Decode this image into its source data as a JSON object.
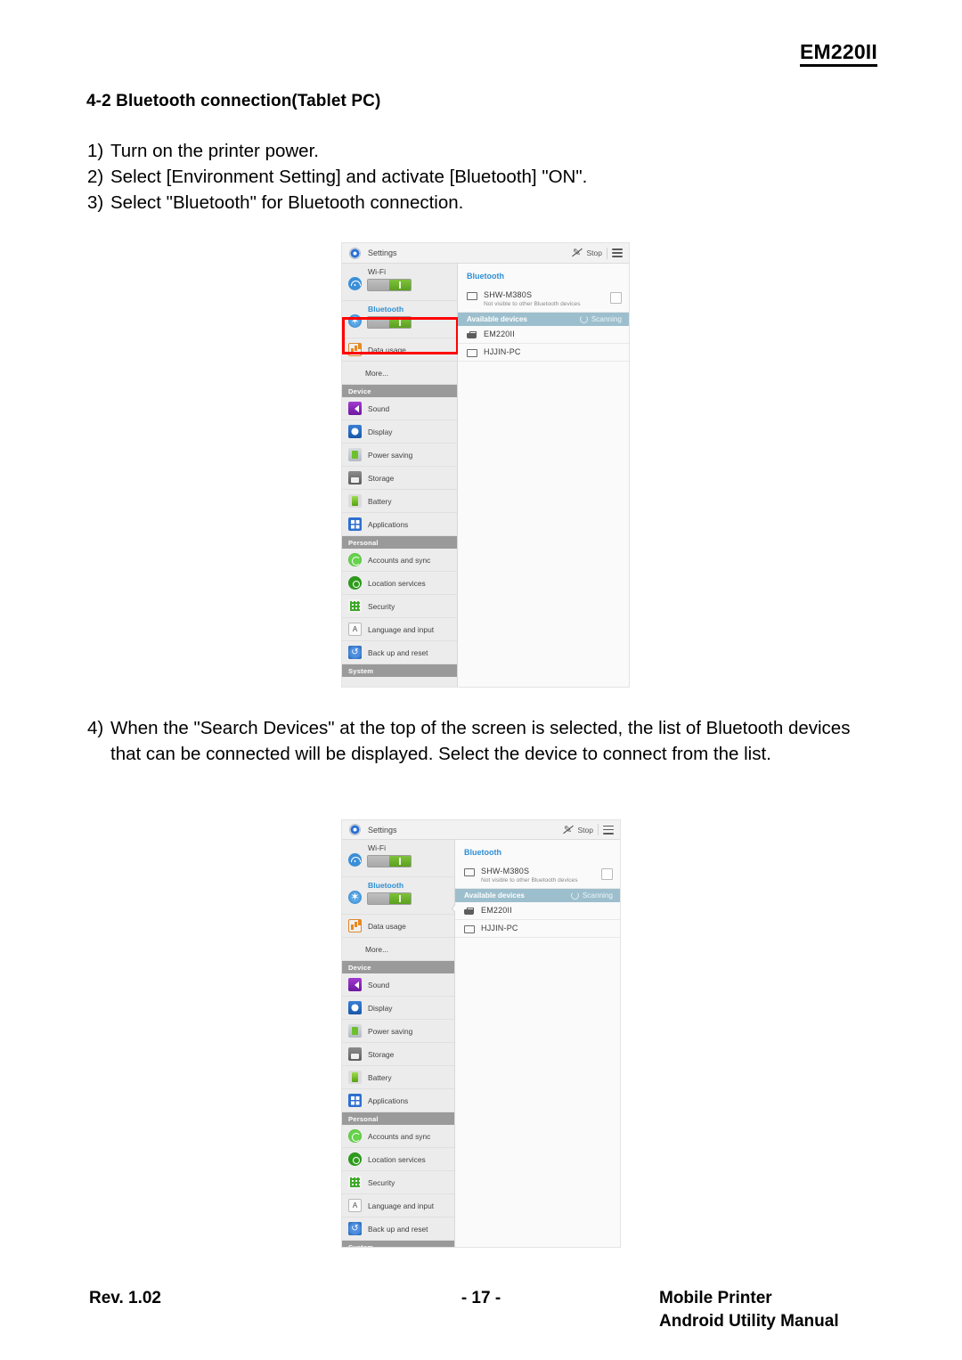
{
  "page": {
    "header_model": "EM220II",
    "section_heading": "4-2 Bluetooth connection(Tablet PC)",
    "steps": [
      {
        "num": "1)",
        "text": "Turn on the printer power."
      },
      {
        "num": "2)",
        "text": "Select [Environment Setting] and activate [Bluetooth] \"ON\"."
      },
      {
        "num": "3)",
        "text": "Select \"Bluetooth\" for Bluetooth connection."
      }
    ],
    "step_four": {
      "num": "4)",
      "text": "When the \"Search Devices\" at the top of the screen is selected, the list of Bluetooth devices that can be connected will be displayed. Select the device to connect from the list."
    },
    "footer": {
      "left": "Rev. 1.02",
      "center": "- 17 -",
      "right_line1": "Mobile Printer",
      "right_line2": "Android Utility Manual"
    },
    "colors": {
      "accent_blue": "#2f8fd4",
      "highlight_red": "#ff0000",
      "available_bar": "#9dbfcd",
      "group_header": "#9a9a9a",
      "toggle_on_green": "#5ba01f"
    }
  },
  "screenshot": {
    "topbar": {
      "app_title": "Settings",
      "stop_label": "Stop",
      "gear_icon": "settings-gear-icon",
      "stop_icon": "stop-scan-icon",
      "menu_icon": "overflow-menu-icon"
    },
    "sidebar": {
      "wireless": [
        {
          "label": "Wi-Fi",
          "icon": "wifi-icon",
          "toggle": "on"
        },
        {
          "label": "Bluetooth",
          "icon": "bluetooth-icon",
          "toggle": "on"
        },
        {
          "label": "Data usage",
          "icon": "data-usage-icon"
        },
        {
          "label": "More...",
          "icon": "none"
        }
      ],
      "group_device": "Device",
      "device_items": [
        {
          "label": "Sound",
          "icon": "sound-icon"
        },
        {
          "label": "Display",
          "icon": "display-icon"
        },
        {
          "label": "Power saving",
          "icon": "power-saving-icon"
        },
        {
          "label": "Storage",
          "icon": "storage-icon"
        },
        {
          "label": "Battery",
          "icon": "battery-icon"
        },
        {
          "label": "Applications",
          "icon": "applications-icon"
        }
      ],
      "group_personal": "Personal",
      "personal_items": [
        {
          "label": "Accounts and sync",
          "icon": "accounts-sync-icon"
        },
        {
          "label": "Location services",
          "icon": "location-services-icon"
        },
        {
          "label": "Security",
          "icon": "security-icon"
        },
        {
          "label": "Language and input",
          "icon": "language-input-icon"
        },
        {
          "label": "Back up and reset",
          "icon": "backup-reset-icon"
        }
      ],
      "group_system": "System"
    },
    "detail": {
      "title": "Bluetooth",
      "paired_device": {
        "name": "SHW-M380S",
        "subtitle": "Not visible to other Bluetooth devices",
        "icon": "monitor-icon"
      },
      "available_header": "Available devices",
      "scanning_label": "Scanning",
      "devices": [
        {
          "name": "EM220II",
          "icon": "printer-icon"
        },
        {
          "name": "HJJIN-PC",
          "icon": "monitor-icon"
        }
      ]
    }
  }
}
